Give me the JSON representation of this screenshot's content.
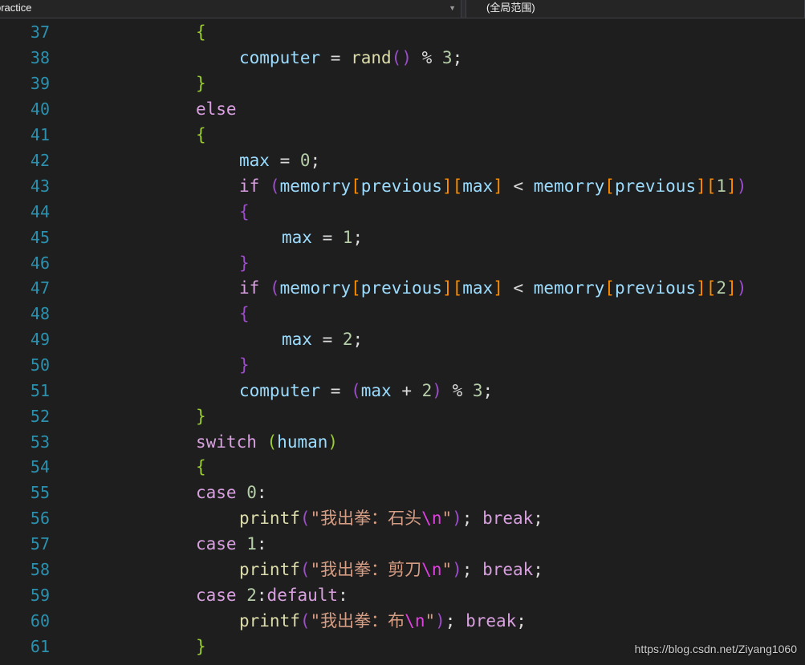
{
  "navbar": {
    "project_label": "practice",
    "scope_label": "(全局范围)"
  },
  "watermark": "https://blog.csdn.net/Ziyang1060",
  "line_numbers": [
    "37",
    "38",
    "39",
    "40",
    "41",
    "42",
    "43",
    "44",
    "45",
    "46",
    "47",
    "48",
    "49",
    "50",
    "51",
    "52",
    "53",
    "54",
    "55",
    "56",
    "57",
    "58",
    "59",
    "60",
    "61"
  ],
  "code": {
    "l37": "{",
    "l38": [
      "computer",
      " = ",
      "rand",
      "(",
      ")",
      " % ",
      "3",
      ";"
    ],
    "l39": "}",
    "l40": "else",
    "l41": "{",
    "l42": [
      "max",
      " = ",
      "0",
      ";"
    ],
    "l43": [
      "if",
      " ",
      "(",
      "memorry",
      "[",
      "previous",
      "]",
      "[",
      "max",
      "]",
      " < ",
      "memorry",
      "[",
      "previous",
      "]",
      "[",
      "1",
      "]",
      ")"
    ],
    "l44": "{",
    "l45": [
      "max",
      " = ",
      "1",
      ";"
    ],
    "l46": "}",
    "l47": [
      "if",
      " ",
      "(",
      "memorry",
      "[",
      "previous",
      "]",
      "[",
      "max",
      "]",
      " < ",
      "memorry",
      "[",
      "previous",
      "]",
      "[",
      "2",
      "]",
      ")"
    ],
    "l48": "{",
    "l49": [
      "max",
      " = ",
      "2",
      ";"
    ],
    "l50": "}",
    "l51": [
      "computer",
      " = ",
      "(",
      "max",
      " + ",
      "2",
      ")",
      " % ",
      "3",
      ";"
    ],
    "l52": "}",
    "l53": [
      "switch",
      " ",
      "(",
      "human",
      ")"
    ],
    "l54": "{",
    "l55": [
      "case",
      " ",
      "0",
      ":"
    ],
    "l56": [
      "printf",
      "(",
      "\"我出拳：石头",
      "\\n",
      "\"",
      ")",
      "; ",
      "break",
      ";"
    ],
    "l57": [
      "case",
      " ",
      "1",
      ":"
    ],
    "l58": [
      "printf",
      "(",
      "\"我出拳：剪刀",
      "\\n",
      "\"",
      ")",
      "; ",
      "break",
      ";"
    ],
    "l59": [
      "case",
      " ",
      "2",
      ":",
      "default",
      ":"
    ],
    "l60": [
      "printf",
      "(",
      "\"我出拳：布",
      "\\n",
      "\"",
      ")",
      "; ",
      "break",
      ";"
    ],
    "l61": "}"
  }
}
